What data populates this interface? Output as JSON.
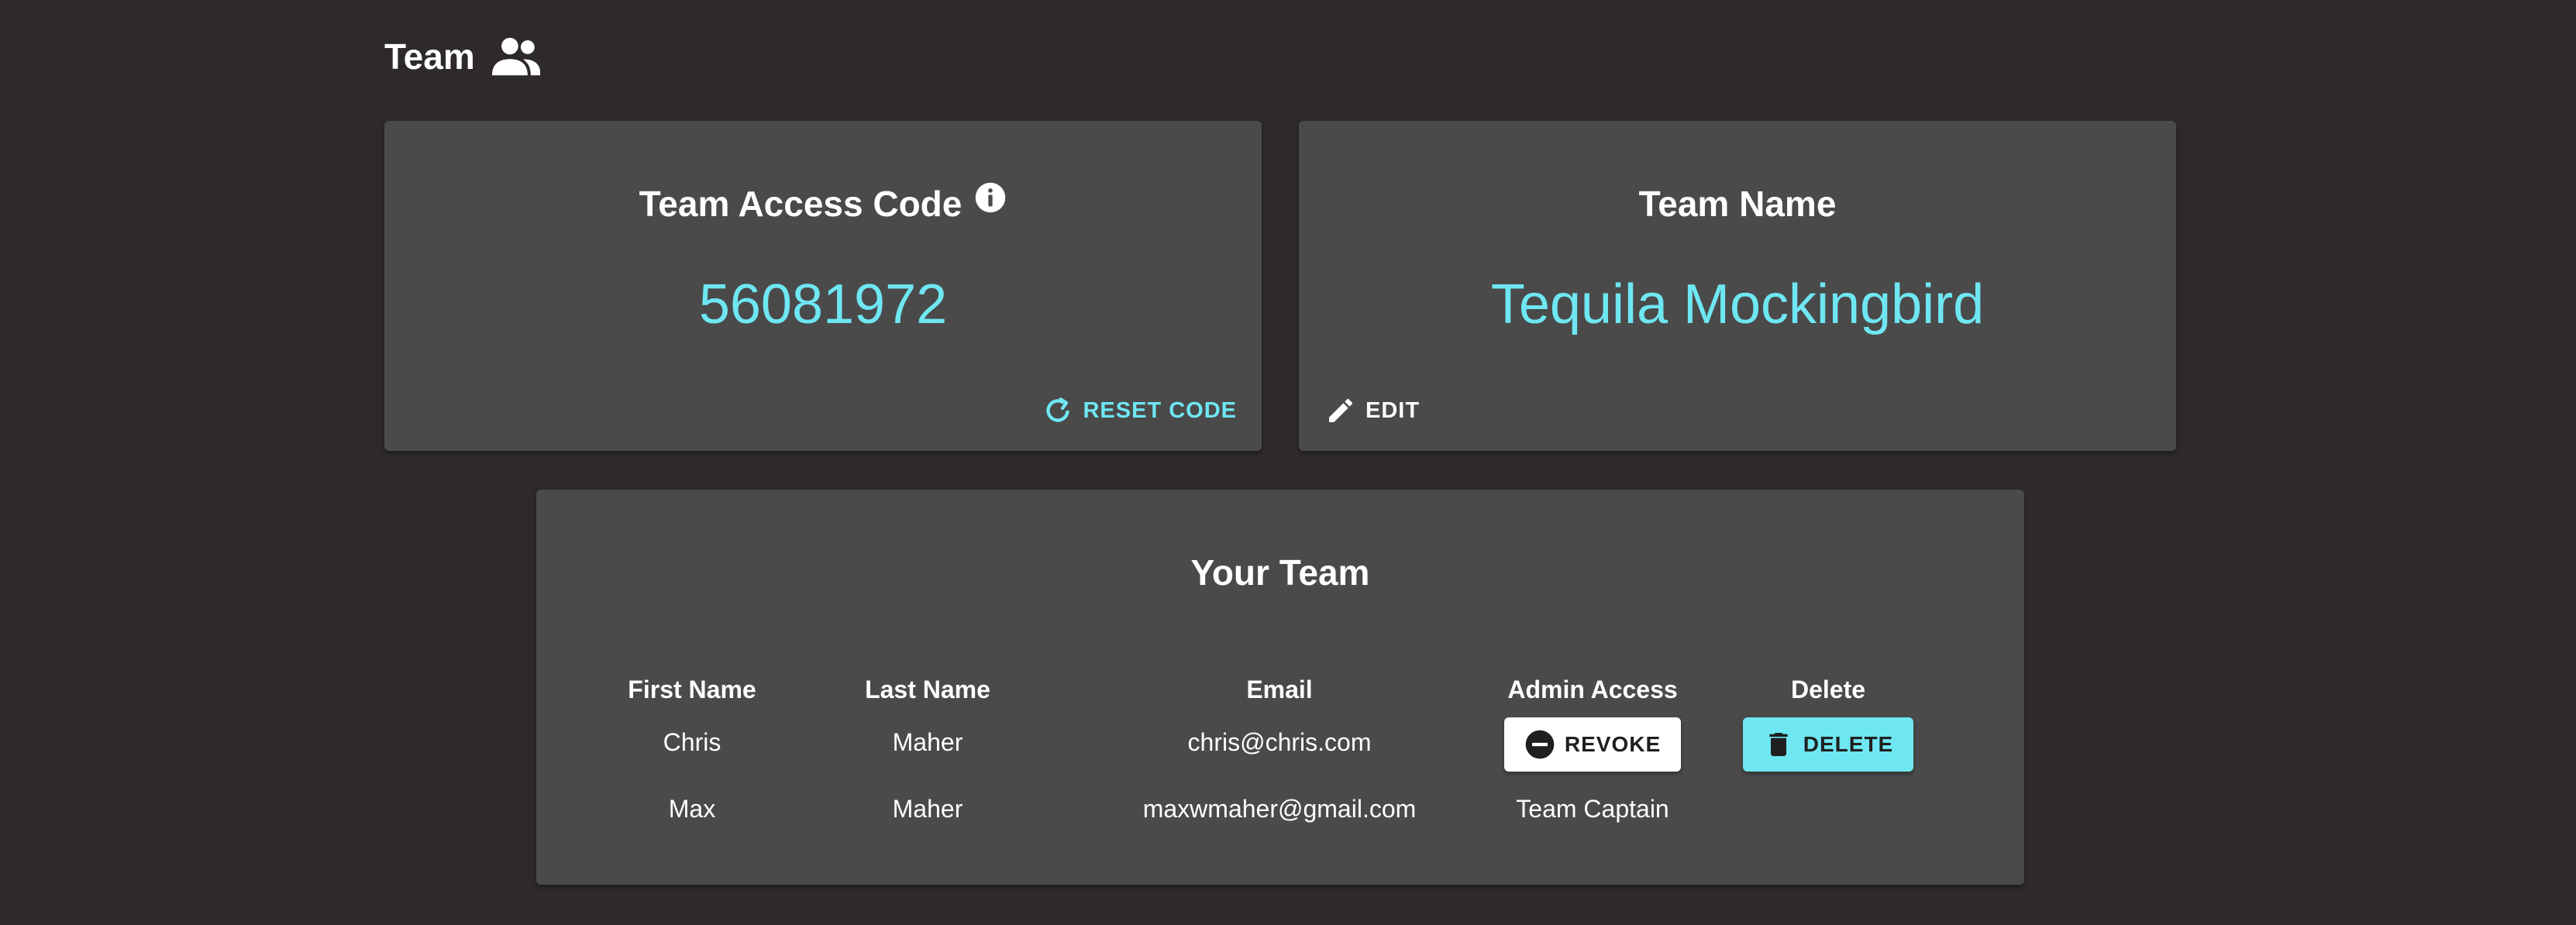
{
  "header": {
    "title": "Team",
    "icon": "people-icon"
  },
  "access_code_card": {
    "title": "Team Access Code",
    "info_icon": "info-icon",
    "code": "56081972",
    "reset_label": "RESET CODE",
    "reset_icon": "refresh-icon"
  },
  "team_name_card": {
    "title": "Team Name",
    "name": "Tequila Mockingbird",
    "edit_label": "EDIT",
    "edit_icon": "pencil-icon"
  },
  "your_team": {
    "title": "Your Team",
    "columns": [
      "First Name",
      "Last Name",
      "Email",
      "Admin Access",
      "Delete"
    ],
    "rows": [
      {
        "first_name": "Chris",
        "last_name": "Maher",
        "email": "chris@chris.com",
        "admin_action": "REVOKE",
        "delete_label": "DELETE"
      },
      {
        "first_name": "Max",
        "last_name": "Maher",
        "email": "maxwmaher@gmail.com",
        "admin_status": "Team Captain"
      }
    ]
  },
  "colors": {
    "background": "#2d2a29",
    "card": "#4a4a4a",
    "accent": "#6ee7f3",
    "text": "#ffffff"
  }
}
